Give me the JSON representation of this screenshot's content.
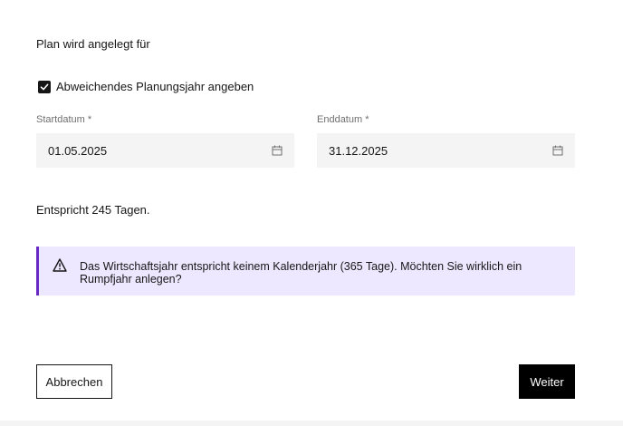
{
  "form": {
    "section_title": "Plan wird angelegt für",
    "checkbox_label": "Abweichendes Planungsjahr angeben",
    "checkbox_checked": true,
    "start": {
      "label": "Startdatum *",
      "value": "01.05.2025"
    },
    "end": {
      "label": "Enddatum *",
      "value": "31.12.2025"
    },
    "days_text": "Entspricht 245 Tagen.",
    "warning_text": "Das Wirtschaftsjahr entspricht keinem Kalenderjahr (365 Tage). Möchten Sie wirklich ein Rumpfjahr anlegen?"
  },
  "actions": {
    "cancel_label": "Abbrechen",
    "next_label": "Weiter"
  },
  "icons": {
    "checkbox": "checkmark-icon",
    "calendar": "calendar-icon",
    "warning": "warning-triangle-icon"
  },
  "colors": {
    "primary": "#161616",
    "field_bg": "#f4f4f4",
    "notice_bg": "#ede8ff",
    "notice_accent": "#6929c4"
  }
}
